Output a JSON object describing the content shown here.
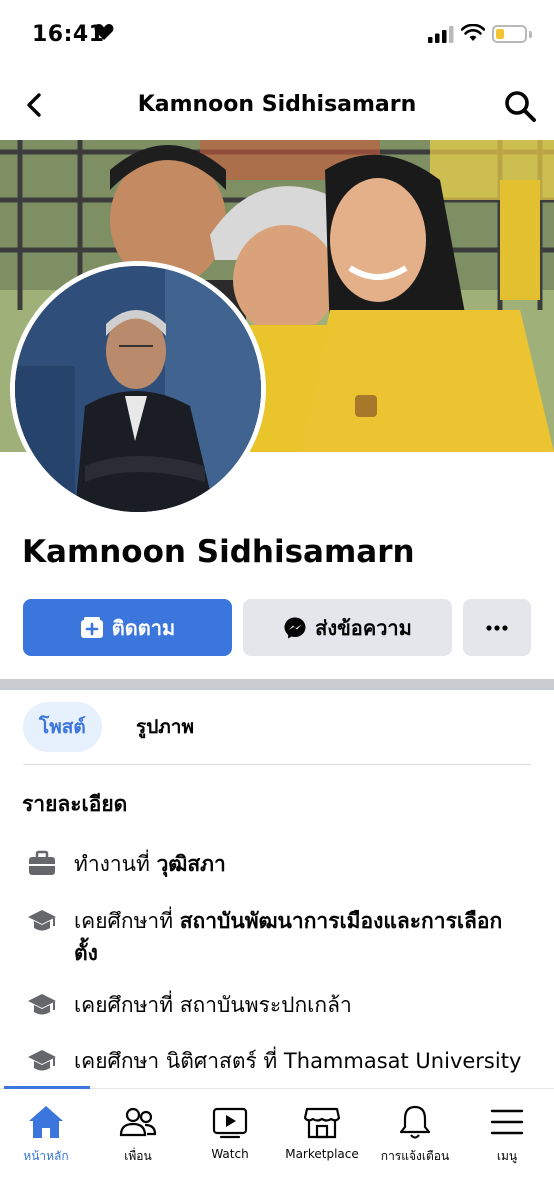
{
  "status_bar": {
    "time": "16:41"
  },
  "header": {
    "title": "Kamnoon Sidhisamarn"
  },
  "profile": {
    "name": "Kamnoon Sidhisamarn"
  },
  "actions": {
    "follow_label": "ติดตาม",
    "message_label": "ส่งข้อความ",
    "more_label": "•••"
  },
  "tabs": [
    {
      "label": "โพสต์"
    },
    {
      "label": "รูปภาพ"
    }
  ],
  "details": {
    "heading": "รายละเอียด",
    "items": [
      {
        "prefix": "ทำงานที่ ",
        "value": "วุฒิสภา"
      },
      {
        "prefix": "เคยศึกษาที่ ",
        "value": "สถาบันพัฒนาการเมืองและการเลือกตั้ง"
      },
      {
        "prefix": "เคยศึกษาที่ สถาบันพระปกเกล้า",
        "value": ""
      },
      {
        "prefix": "เคยศึกษา นิติศาสตร์ ที่ Thammasat University",
        "value": ""
      }
    ]
  },
  "bottom_nav": [
    {
      "label": "หน้าหลัก",
      "icon": "home-icon",
      "active": true
    },
    {
      "label": "เพื่อน",
      "icon": "friends-icon"
    },
    {
      "label": "Watch",
      "icon": "watch-icon"
    },
    {
      "label": "Marketplace",
      "icon": "marketplace-icon"
    },
    {
      "label": "การแจ้งเตือน",
      "icon": "bell-icon"
    },
    {
      "label": "เมนู",
      "icon": "menu-icon"
    }
  ],
  "colors": {
    "accent": "#3a76db",
    "button_gray": "#e4e6eb",
    "divider": "#c9ccd1"
  }
}
